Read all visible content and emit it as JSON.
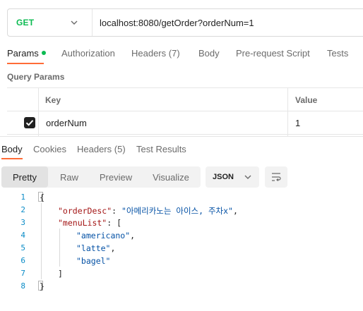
{
  "request": {
    "method": "GET",
    "url": "localhost:8080/getOrder?orderNum=1"
  },
  "request_tabs": {
    "params": "Params",
    "authorization": "Authorization",
    "headers": "Headers",
    "headers_count": "(7)",
    "body": "Body",
    "prerequest": "Pre-request Script",
    "tests": "Tests"
  },
  "query_params": {
    "title": "Query Params",
    "header_key": "Key",
    "header_value": "Value",
    "rows": [
      {
        "key": "orderNum",
        "value": "1",
        "checked": true
      }
    ]
  },
  "response_tabs": {
    "body": "Body",
    "cookies": "Cookies",
    "headers": "Headers",
    "headers_count": "(5)",
    "test_results": "Test Results"
  },
  "toolbar": {
    "pretty": "Pretty",
    "raw": "Raw",
    "preview": "Preview",
    "visualize": "Visualize",
    "format": "JSON"
  },
  "code_lines": [
    {
      "n": "1"
    },
    {
      "n": "2",
      "key": "\"orderDesc\"",
      "sep": ": ",
      "val": "\"아메리카노는 아이스, 주차x\"",
      "end": ","
    },
    {
      "n": "3",
      "key": "\"menuList\"",
      "sep": ": ",
      "val": "["
    },
    {
      "n": "4",
      "val": "\"americano\"",
      "end": ","
    },
    {
      "n": "5",
      "val": "\"latte\"",
      "end": ","
    },
    {
      "n": "6",
      "val": "\"bagel\""
    },
    {
      "n": "7",
      "val": "]"
    },
    {
      "n": "8"
    }
  ],
  "colors": {
    "method": "#0cbb52",
    "accent": "#ff6c37",
    "json_key": "#a31515",
    "json_string": "#0451a5",
    "line_number": "#0b8cc7"
  },
  "icons": [
    "chevron-down-icon",
    "checkbox-checked-icon",
    "wrap-lines-icon"
  ]
}
